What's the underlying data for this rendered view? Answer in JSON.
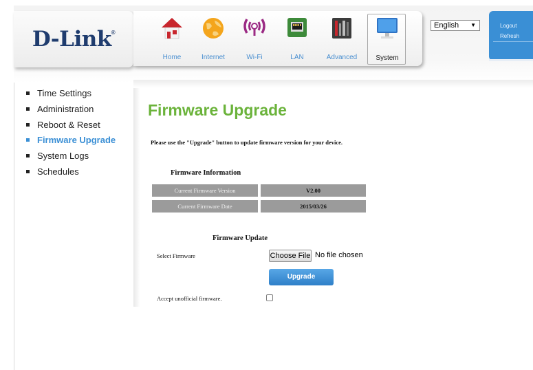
{
  "header": {
    "brand": "D-Link",
    "nav": [
      {
        "label": "Home",
        "icon": "home-icon"
      },
      {
        "label": "Internet",
        "icon": "globe-icon"
      },
      {
        "label": "Wi-Fi",
        "icon": "wifi-icon"
      },
      {
        "label": "LAN",
        "icon": "lan-port-icon"
      },
      {
        "label": "Advanced",
        "icon": "tools-icon"
      },
      {
        "label": "System",
        "icon": "computer-icon",
        "active": true
      }
    ],
    "language": {
      "selected": "English"
    },
    "links": {
      "logout": "Logout",
      "refresh": "Refresh"
    }
  },
  "sidebar": {
    "items": [
      {
        "label": "Time Settings"
      },
      {
        "label": "Administration"
      },
      {
        "label": "Reboot & Reset"
      },
      {
        "label": "Firmware Upgrade",
        "active": true
      },
      {
        "label": "System Logs"
      },
      {
        "label": "Schedules"
      }
    ]
  },
  "main": {
    "title": "Firmware Upgrade",
    "description": "Please use the \"Upgrade\" button to update firmware version for your device.",
    "firmware_info": {
      "heading": "Firmware Information",
      "rows": [
        {
          "label": "Current Firmware Version",
          "value": "V2.00"
        },
        {
          "label": "Current Firmware Date",
          "value": "2015/03/26"
        }
      ]
    },
    "firmware_update": {
      "heading": "Firmware Update",
      "select_label": "Select Firmware",
      "choose_file_button": "Choose File",
      "file_status": "No file chosen",
      "upgrade_button": "Upgrade",
      "unofficial_label": "Accept unofficial firmware.",
      "unofficial_checked": false
    }
  },
  "colors": {
    "brand_blue": "#1f3c6e",
    "accent_blue": "#3a8fd5",
    "title_green": "#6bb33b",
    "table_gray": "#9b9b9b"
  }
}
